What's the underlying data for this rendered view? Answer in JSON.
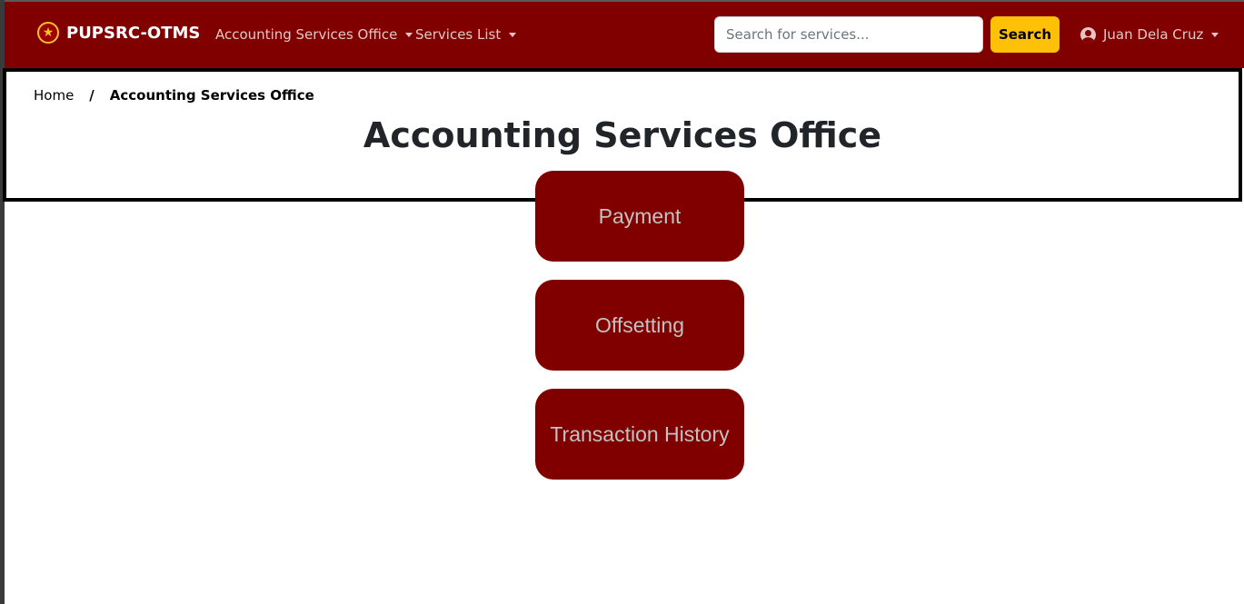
{
  "navbar": {
    "brand": "PUPSRC-OTMS",
    "brand_icon": "star-logo-icon",
    "menu_office": "Accounting Services Office",
    "menu_services": "Services List",
    "search_placeholder": "Search for services...",
    "search_value": "",
    "search_button": "Search",
    "user_name": "Juan Dela Cruz",
    "user_icon": "user-circle-icon"
  },
  "breadcrumb": {
    "home": "Home",
    "separator": "/",
    "current": "Accounting Services Office"
  },
  "page": {
    "title": "Accounting Services Office"
  },
  "services": [
    {
      "label": "Payment"
    },
    {
      "label": "Offsetting"
    },
    {
      "label": "Transaction History"
    }
  ],
  "colors": {
    "primary": "#800000",
    "search_button": "#ffc107",
    "service_text": "#c2c2c2"
  }
}
